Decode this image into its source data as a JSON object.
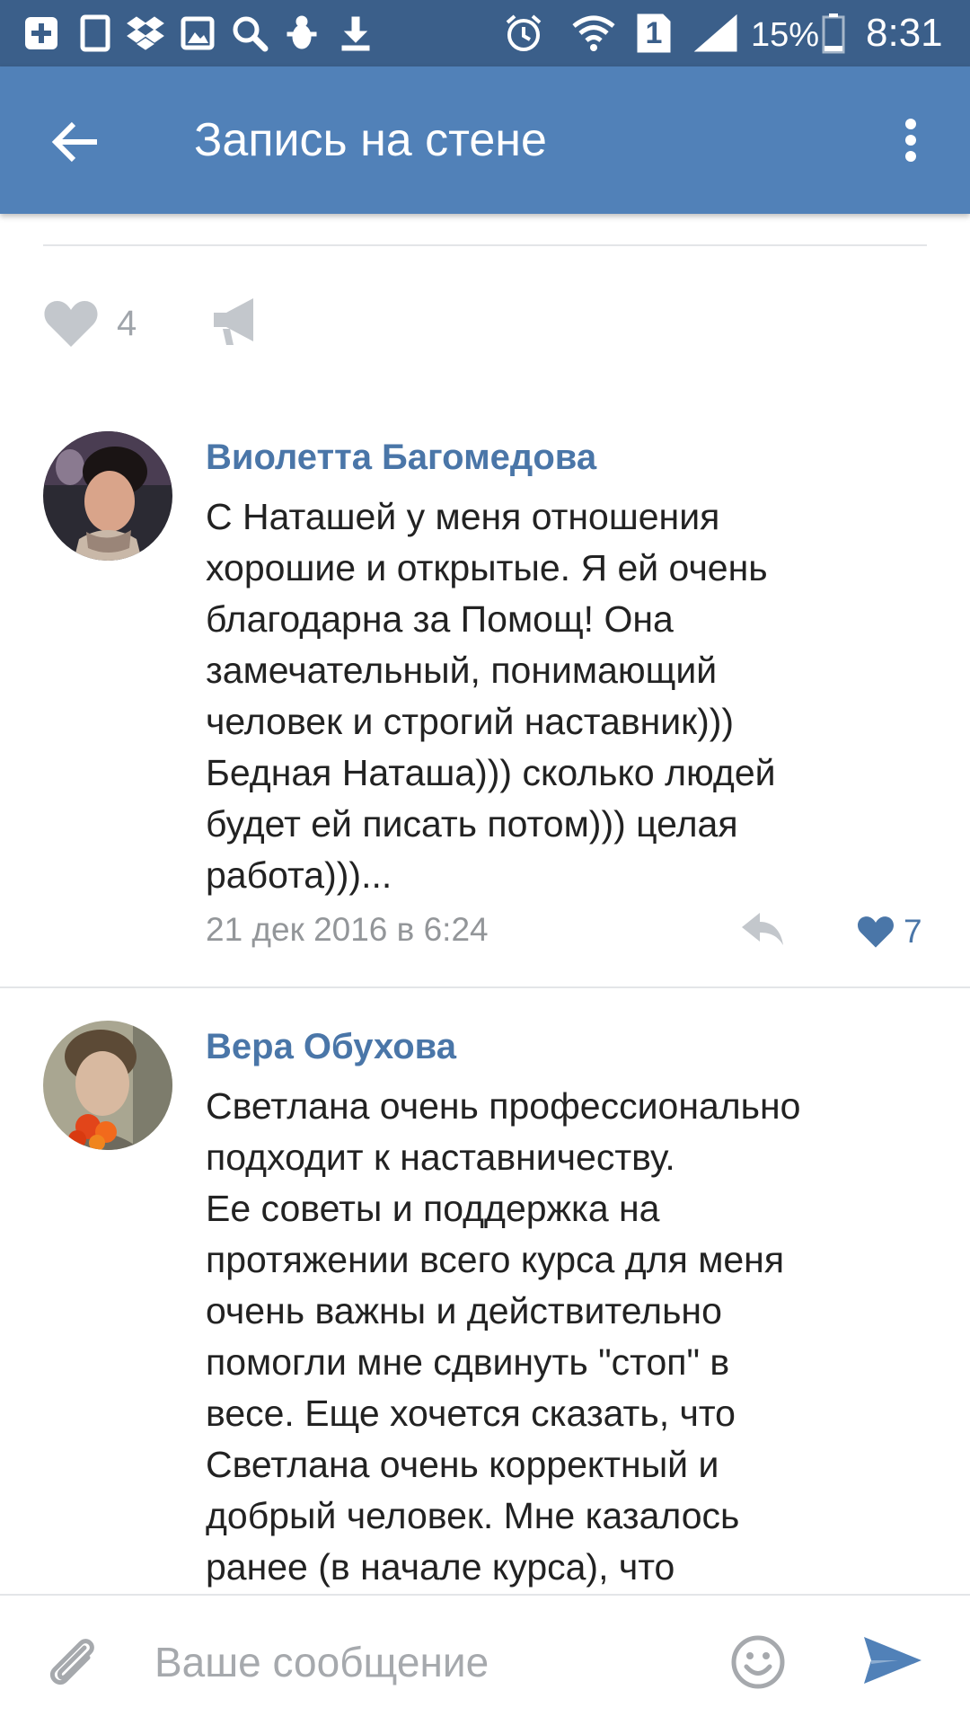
{
  "status_bar": {
    "icons": [
      "add-icon",
      "tablet-icon",
      "dropbox-icon",
      "gallery-icon",
      "search-icon",
      "bug-icon",
      "download-icon",
      "alarm-icon",
      "wifi-icon",
      "sim-icon",
      "signal-icon",
      "battery-icon"
    ],
    "sim_label": "1",
    "battery_percent": "15%",
    "time": "8:31",
    "color": "#3b5f8a"
  },
  "app_bar": {
    "title": "Запись на стене",
    "color": "#5181b8"
  },
  "post": {
    "like_count": "4"
  },
  "comments": [
    {
      "author": "Виолетта Багомедова",
      "text": "С Наташей у меня отношения\nхорошие и открытые. Я ей очень\nблагодарна за Помощ! Она\nзамечательный, понимающий\nчеловек и строгий наставник)))\nБедная Наташа))) сколько людей\nбудет ей писать потом))) целая\nработа)))...",
      "date": "21 дек 2016 в 6:24",
      "like_count": "7"
    },
    {
      "author": "Вера Обухова",
      "text": "Светлана очень профессионально\nподходит к наставничеству.\nЕе советы и поддержка на\nпротяжении всего курса для меня\nочень важны и действительно\nпомогли мне сдвинуть \"стоп\" в\nвесе. Еще хочется сказать, что\nСветлана очень корректный и\nдобрый человек. Мне казалось\nранее (в начале курса), что"
    }
  ],
  "compose": {
    "placeholder": "Ваше сообщение"
  },
  "colors": {
    "link": "#4a76a8",
    "muted": "#939699",
    "divider": "#e3e5e8"
  }
}
